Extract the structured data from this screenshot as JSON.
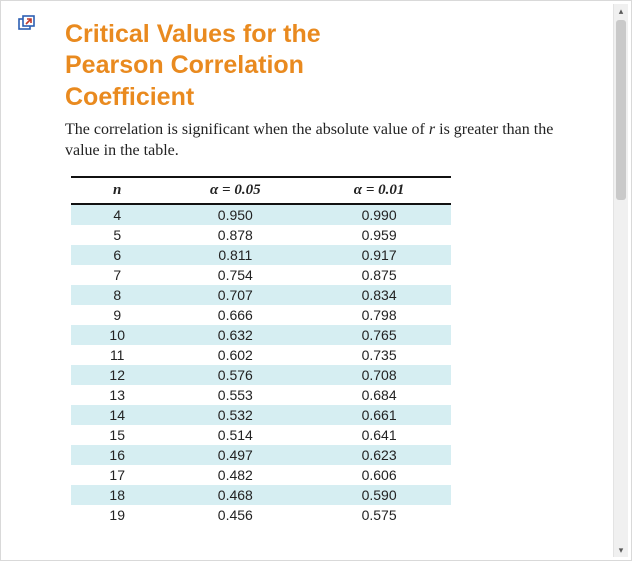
{
  "title": "Critical Values for the Pearson Correlation Coefficient",
  "intro_prefix": "The correlation is significant when the absolute value of ",
  "intro_var": "r",
  "intro_suffix": " is greater than the value in the table.",
  "headers": {
    "n": "n",
    "a05": "α = 0.05",
    "a01": "α = 0.01"
  },
  "chart_data": {
    "type": "table",
    "title": "Critical Values for the Pearson Correlation Coefficient",
    "columns": [
      "n",
      "alpha_0.05",
      "alpha_0.01"
    ],
    "rows": [
      {
        "n": 4,
        "a05": "0.950",
        "a01": "0.990"
      },
      {
        "n": 5,
        "a05": "0.878",
        "a01": "0.959"
      },
      {
        "n": 6,
        "a05": "0.811",
        "a01": "0.917"
      },
      {
        "n": 7,
        "a05": "0.754",
        "a01": "0.875"
      },
      {
        "n": 8,
        "a05": "0.707",
        "a01": "0.834"
      },
      {
        "n": 9,
        "a05": "0.666",
        "a01": "0.798"
      },
      {
        "n": 10,
        "a05": "0.632",
        "a01": "0.765"
      },
      {
        "n": 11,
        "a05": "0.602",
        "a01": "0.735"
      },
      {
        "n": 12,
        "a05": "0.576",
        "a01": "0.708"
      },
      {
        "n": 13,
        "a05": "0.553",
        "a01": "0.684"
      },
      {
        "n": 14,
        "a05": "0.532",
        "a01": "0.661"
      },
      {
        "n": 15,
        "a05": "0.514",
        "a01": "0.641"
      },
      {
        "n": 16,
        "a05": "0.497",
        "a01": "0.623"
      },
      {
        "n": 17,
        "a05": "0.482",
        "a01": "0.606"
      },
      {
        "n": 18,
        "a05": "0.468",
        "a01": "0.590"
      },
      {
        "n": 19,
        "a05": "0.456",
        "a01": "0.575"
      }
    ]
  }
}
